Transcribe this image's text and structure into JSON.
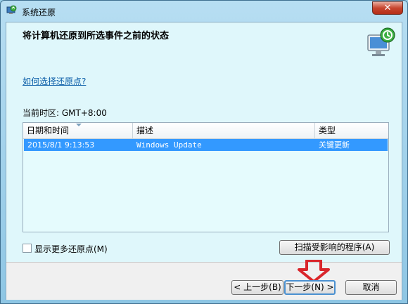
{
  "window": {
    "title": "系统还原",
    "close_label": "✕"
  },
  "header": {
    "title": "将计算机还原到所选事件之前的状态",
    "icon": "system-restore-icon"
  },
  "main": {
    "help_link": "如何选择还原点?",
    "timezone": "当前时区: GMT+8:00"
  },
  "list": {
    "columns": [
      "日期和时间",
      "描述",
      "类型"
    ],
    "rows": [
      {
        "date": "2015/8/1 9:13:53",
        "description": "Windows Update",
        "type": "关键更新",
        "selected": true
      }
    ]
  },
  "options": {
    "show_more_label": "显示更多还原点(M)",
    "show_more_checked": false,
    "scan_button": "扫描受影响的程序(A)"
  },
  "footer": {
    "back_button": "< 上一步(B)",
    "next_button": "下一步(N) >",
    "cancel_button": "取消"
  },
  "colors": {
    "selection": "#3399ff",
    "panel": "#dff7fb",
    "arrow": "#d9262b"
  }
}
